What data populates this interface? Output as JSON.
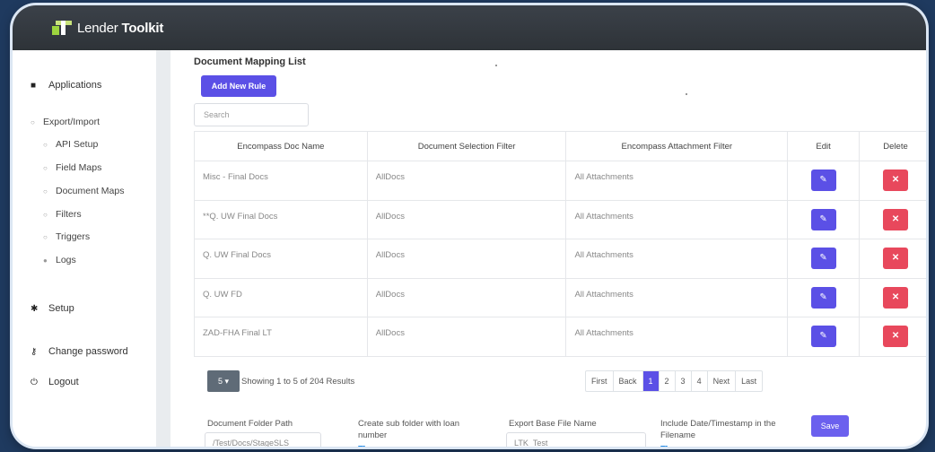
{
  "app": {
    "logo_text_light": "Lender ",
    "logo_text_bold": "Toolkit"
  },
  "sidebar": {
    "applications": "Applications",
    "export_import": "Export/Import",
    "sub_items": [
      "API Setup",
      "Field Maps",
      "Document Maps",
      "Filters",
      "Triggers"
    ],
    "logs": "Logs",
    "setup": "Setup",
    "change_password": "Change password",
    "logout": "Logout"
  },
  "main": {
    "title": "Document Mapping List",
    "add_button": "Add New Rule",
    "search_placeholder": "Search",
    "columns": [
      "Encompass Doc Name",
      "Document Selection Filter",
      "Encompass Attachment Filter",
      "Edit",
      "Delete"
    ],
    "rows": [
      {
        "doc": "Misc - Final Docs",
        "filter": "AllDocs",
        "attach": "All Attachments"
      },
      {
        "doc": "**Q. UW Final Docs",
        "filter": "AllDocs",
        "attach": "All Attachments"
      },
      {
        "doc": "Q. UW Final Docs",
        "filter": "AllDocs",
        "attach": "All Attachments"
      },
      {
        "doc": "Q. UW FD",
        "filter": "AllDocs",
        "attach": "All Attachments"
      },
      {
        "doc": "ZAD-FHA Final LT",
        "filter": "AllDocs",
        "attach": "All Attachments"
      }
    ],
    "page_size": "5",
    "results_text": "Showing 1 to 5 of 204 Results",
    "pager": [
      "First",
      "Back",
      "1",
      "2",
      "3",
      "4",
      "Next",
      "Last"
    ],
    "active_page": "1"
  },
  "settings": {
    "folder_label": "Document Folder Path",
    "folder_value": "/Test/Docs/StageSLS",
    "subfolder_label": "Create sub folder with loan number",
    "filename_label": "Export Base File Name",
    "filename_value": "LTK_Test",
    "timestamp_label": "Include Date/Timestamp in the Filename",
    "save_button": "Save"
  },
  "colors": {
    "primary": "#5b50e6",
    "danger": "#e8485c",
    "topbar": "#2e3338"
  }
}
